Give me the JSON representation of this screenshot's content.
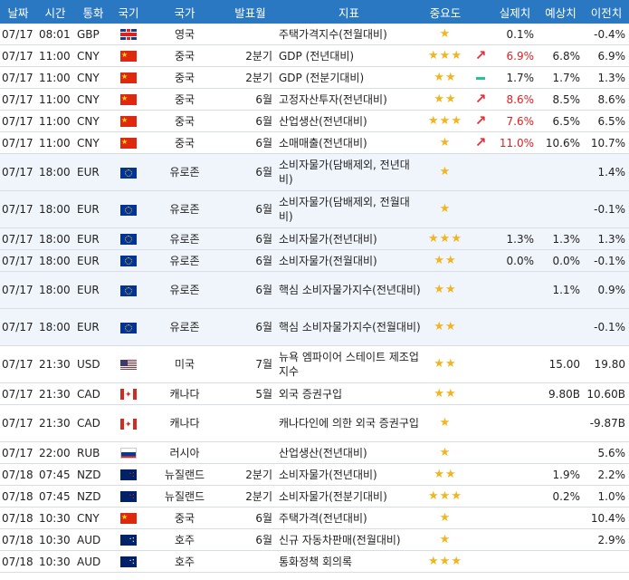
{
  "headers": [
    "날짜",
    "시간",
    "통화",
    "국기",
    "국가",
    "발표월",
    "지표",
    "중요도",
    "",
    "실제치",
    "예상치",
    "이전치"
  ],
  "rows": [
    {
      "date": "07/17",
      "time": "08:01",
      "cur": "GBP",
      "flag": "gb",
      "country": "영국",
      "period": "",
      "ind": "주택가격지수(전월대비)",
      "stars": "★",
      "trend": "",
      "actual": "0.1%",
      "forecast": "",
      "prev": "-0.4%",
      "red": false,
      "tall": false,
      "blue": false
    },
    {
      "date": "07/17",
      "time": "11:00",
      "cur": "CNY",
      "flag": "cn",
      "country": "중국",
      "period": "2분기",
      "ind": "GDP (전년대비)",
      "stars": "★★★",
      "trend": "up",
      "actual": "6.9%",
      "forecast": "6.8%",
      "prev": "6.9%",
      "red": true,
      "tall": false,
      "blue": false
    },
    {
      "date": "07/17",
      "time": "11:00",
      "cur": "CNY",
      "flag": "cn",
      "country": "중국",
      "period": "2분기",
      "ind": "GDP (전분기대비)",
      "stars": "★★",
      "trend": "flat",
      "actual": "1.7%",
      "forecast": "1.7%",
      "prev": "1.3%",
      "red": false,
      "tall": false,
      "blue": false
    },
    {
      "date": "07/17",
      "time": "11:00",
      "cur": "CNY",
      "flag": "cn",
      "country": "중국",
      "period": "6월",
      "ind": "고정자산투자(전년대비)",
      "stars": "★★",
      "trend": "up",
      "actual": "8.6%",
      "forecast": "8.5%",
      "prev": "8.6%",
      "red": true,
      "tall": false,
      "blue": false
    },
    {
      "date": "07/17",
      "time": "11:00",
      "cur": "CNY",
      "flag": "cn",
      "country": "중국",
      "period": "6월",
      "ind": "산업생산(전년대비)",
      "stars": "★★★",
      "trend": "up",
      "actual": "7.6%",
      "forecast": "6.5%",
      "prev": "6.5%",
      "red": true,
      "tall": false,
      "blue": false
    },
    {
      "date": "07/17",
      "time": "11:00",
      "cur": "CNY",
      "flag": "cn",
      "country": "중국",
      "period": "6월",
      "ind": "소매매출(전년대비)",
      "stars": "★",
      "trend": "up",
      "actual": "11.0%",
      "forecast": "10.6%",
      "prev": "10.7%",
      "red": true,
      "tall": false,
      "blue": false
    },
    {
      "date": "07/17",
      "time": "18:00",
      "cur": "EUR",
      "flag": "eu",
      "country": "유로존",
      "period": "6월",
      "ind": "소비자물가(담배제외, 전년대비)",
      "stars": "★",
      "trend": "",
      "actual": "",
      "forecast": "",
      "prev": "1.4%",
      "red": false,
      "tall": true,
      "blue": true
    },
    {
      "date": "07/17",
      "time": "18:00",
      "cur": "EUR",
      "flag": "eu",
      "country": "유로존",
      "period": "6월",
      "ind": "소비자물가(담배제외, 전월대비)",
      "stars": "★",
      "trend": "",
      "actual": "",
      "forecast": "",
      "prev": "-0.1%",
      "red": false,
      "tall": true,
      "blue": true
    },
    {
      "date": "07/17",
      "time": "18:00",
      "cur": "EUR",
      "flag": "eu",
      "country": "유로존",
      "period": "6월",
      "ind": "소비자물가(전년대비)",
      "stars": "★★★",
      "trend": "",
      "actual": "1.3%",
      "forecast": "1.3%",
      "prev": "1.3%",
      "red": false,
      "tall": false,
      "blue": true
    },
    {
      "date": "07/17",
      "time": "18:00",
      "cur": "EUR",
      "flag": "eu",
      "country": "유로존",
      "period": "6월",
      "ind": "소비자물가(전월대비)",
      "stars": "★★",
      "trend": "",
      "actual": "0.0%",
      "forecast": "0.0%",
      "prev": "-0.1%",
      "red": false,
      "tall": false,
      "blue": true
    },
    {
      "date": "07/17",
      "time": "18:00",
      "cur": "EUR",
      "flag": "eu",
      "country": "유로존",
      "period": "6월",
      "ind": "핵심 소비자물가지수(전년대비)",
      "stars": "★★",
      "trend": "",
      "actual": "",
      "forecast": "1.1%",
      "prev": "0.9%",
      "red": false,
      "tall": true,
      "blue": true
    },
    {
      "date": "07/17",
      "time": "18:00",
      "cur": "EUR",
      "flag": "eu",
      "country": "유로존",
      "period": "6월",
      "ind": "핵심 소비자물가지수(전월대비)",
      "stars": "★★",
      "trend": "",
      "actual": "",
      "forecast": "",
      "prev": "-0.1%",
      "red": false,
      "tall": true,
      "blue": true
    },
    {
      "date": "07/17",
      "time": "21:30",
      "cur": "USD",
      "flag": "us",
      "country": "미국",
      "period": "7월",
      "ind": "뉴욕 엠파이어 스테이트 제조업 지수",
      "stars": "★★",
      "trend": "",
      "actual": "",
      "forecast": "15.00",
      "prev": "19.80",
      "red": false,
      "tall": true,
      "blue": false
    },
    {
      "date": "07/17",
      "time": "21:30",
      "cur": "CAD",
      "flag": "ca",
      "country": "캐나다",
      "period": "5월",
      "ind": "외국 증권구입",
      "stars": "★★",
      "trend": "",
      "actual": "",
      "forecast": "9.80B",
      "prev": "10.60B",
      "red": false,
      "tall": false,
      "blue": false
    },
    {
      "date": "07/17",
      "time": "21:30",
      "cur": "CAD",
      "flag": "ca",
      "country": "캐나다",
      "period": "",
      "ind": "캐나다인에 의한 외국 증권구입",
      "stars": "★",
      "trend": "",
      "actual": "",
      "forecast": "",
      "prev": "-9.87B",
      "red": false,
      "tall": true,
      "blue": false
    },
    {
      "date": "07/17",
      "time": "22:00",
      "cur": "RUB",
      "flag": "ru",
      "country": "러시아",
      "period": "",
      "ind": "산업생산(전년대비)",
      "stars": "★",
      "trend": "",
      "actual": "",
      "forecast": "",
      "prev": "5.6%",
      "red": false,
      "tall": false,
      "blue": false
    },
    {
      "date": "07/18",
      "time": "07:45",
      "cur": "NZD",
      "flag": "nz",
      "country": "뉴질랜드",
      "period": "2분기",
      "ind": "소비자물가(전년대비)",
      "stars": "★★",
      "trend": "",
      "actual": "",
      "forecast": "1.9%",
      "prev": "2.2%",
      "red": false,
      "tall": false,
      "blue": false
    },
    {
      "date": "07/18",
      "time": "07:45",
      "cur": "NZD",
      "flag": "nz",
      "country": "뉴질랜드",
      "period": "2분기",
      "ind": "소비자물가(전분기대비)",
      "stars": "★★★",
      "trend": "",
      "actual": "",
      "forecast": "0.2%",
      "prev": "1.0%",
      "red": false,
      "tall": false,
      "blue": false
    },
    {
      "date": "07/18",
      "time": "10:30",
      "cur": "CNY",
      "flag": "cn",
      "country": "중국",
      "period": "6월",
      "ind": "주택가격(전년대비)",
      "stars": "★",
      "trend": "",
      "actual": "",
      "forecast": "",
      "prev": "10.4%",
      "red": false,
      "tall": false,
      "blue": false
    },
    {
      "date": "07/18",
      "time": "10:30",
      "cur": "AUD",
      "flag": "au",
      "country": "호주",
      "period": "6월",
      "ind": "신규 자동차판매(전월대비)",
      "stars": "★",
      "trend": "",
      "actual": "",
      "forecast": "",
      "prev": "2.9%",
      "red": false,
      "tall": false,
      "blue": false
    },
    {
      "date": "07/18",
      "time": "10:30",
      "cur": "AUD",
      "flag": "au",
      "country": "호주",
      "period": "",
      "ind": "통화정책 회의록",
      "stars": "★★★",
      "trend": "",
      "actual": "",
      "forecast": "",
      "prev": "",
      "red": false,
      "tall": false,
      "blue": false
    }
  ]
}
